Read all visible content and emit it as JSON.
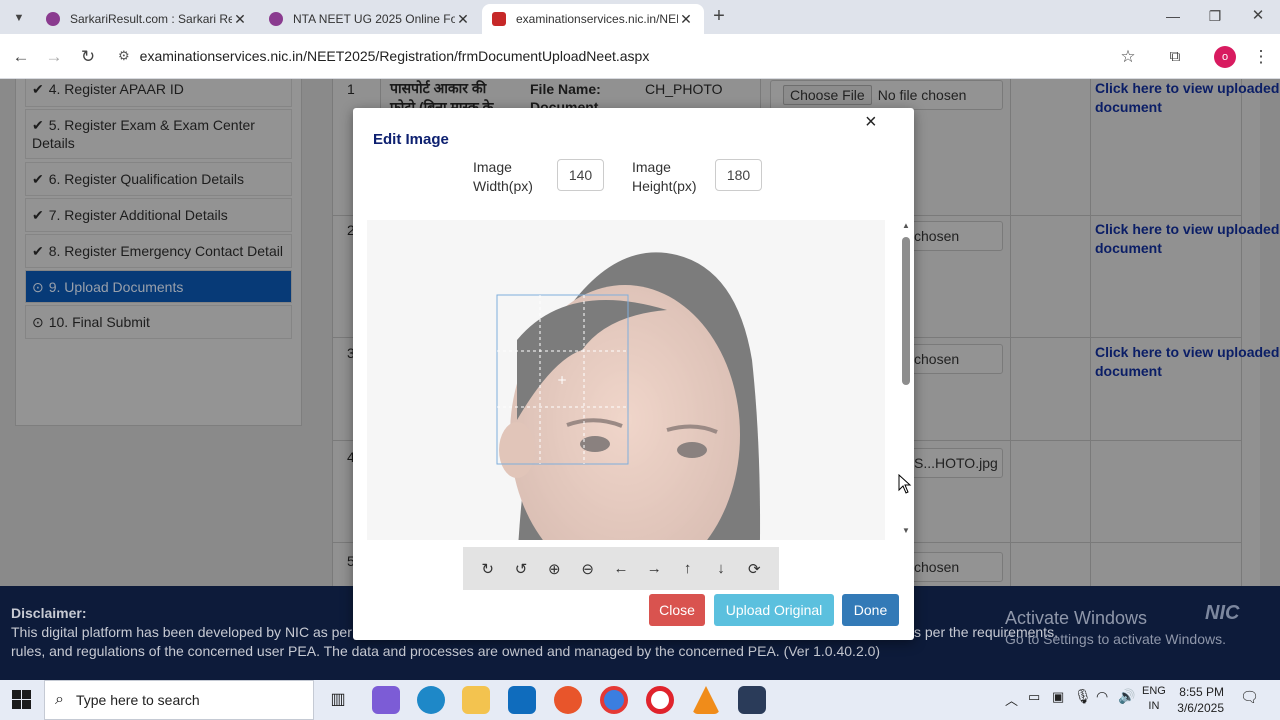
{
  "browser": {
    "tabs": [
      {
        "title": "SarkariResult.com : Sarkari Resu",
        "active": false
      },
      {
        "title": "NTA NEET UG 2025 Online Form",
        "active": false
      },
      {
        "title": "examinationservices.nic.in/NEET",
        "active": true
      }
    ],
    "new_tab": "+",
    "url": "examinationservices.nic.in/NEET2025/Registration/frmDocumentUploadNeet.aspx",
    "profile_initial": "o"
  },
  "sidebar": {
    "items": [
      {
        "label": "4. Register APAAR ID",
        "icon": "check-circle-icon"
      },
      {
        "label": "5. Register Exam & Exam Center Details",
        "icon": "check-circle-icon"
      },
      {
        "label": "6. Register Qualification Details",
        "icon": "check-circle-icon"
      },
      {
        "label": "7. Register Additional Details",
        "icon": "check-circle-icon"
      },
      {
        "label": "8. Register Emergency Contact Detail",
        "icon": "check-circle-icon"
      },
      {
        "label": "9. Upload Documents",
        "icon": "clock-icon",
        "active": true
      },
      {
        "label": "10. Final Submit",
        "icon": "clock-icon"
      }
    ]
  },
  "table": {
    "row1": {
      "num": "1",
      "desc": "पासपोर्ट आकार की फ़ोटो (बिना मास्क के",
      "file_name_label": "File Name:",
      "file_name_value": "CH_PHOTO",
      "document_label": "Document",
      "choose_file": "Choose File",
      "no_file": "No file chosen",
      "view_link": "Click here to view uploaded document"
    },
    "row2": {
      "num": "2",
      "file_text": "chosen",
      "view_link": "Click here to view uploaded document"
    },
    "row3": {
      "num": "3",
      "file_text": "chosen",
      "view_link": "Click here to view uploaded document"
    },
    "row4": {
      "num": "4",
      "file_text": "S...HOTO.jpg"
    },
    "row5": {
      "num": "5",
      "file_text": "chosen"
    }
  },
  "modal": {
    "title": "Edit Image",
    "close_glyph": "×",
    "width_label": "Image Width(px)",
    "width_value": "140",
    "height_label": "Image Height(px)",
    "height_value": "180",
    "toolbar": [
      "rotate-right-icon",
      "rotate-left-icon",
      "zoom-in-icon",
      "zoom-out-icon",
      "arrow-left-icon",
      "arrow-right-icon",
      "arrow-up-icon",
      "arrow-down-icon",
      "reset-icon"
    ],
    "buttons": {
      "close": "Close",
      "upload_original": "Upload Original",
      "done": "Done"
    },
    "colors": {
      "close": "#d9534f",
      "upload_original": "#5bc0de",
      "done": "#337ab7"
    }
  },
  "disclaimer": {
    "heading": "Disclaimer:",
    "line1_left": "This digital platform has been developed by NIC as per t",
    "line1_right": "s per the requirements,",
    "line2": "rules, and regulations of the concerned user PEA. The data and processes are owned and managed by the concerned PEA. (Ver 1.0.40.2.0)",
    "activate_title": "Activate Windows",
    "activate_sub": "Go to Settings to activate Windows.",
    "nic_logo": "NIC"
  },
  "taskbar": {
    "search_placeholder": "Type here to search",
    "lang": "ENG",
    "region": "IN",
    "time": "8:55 PM",
    "date": "3/6/2025"
  }
}
